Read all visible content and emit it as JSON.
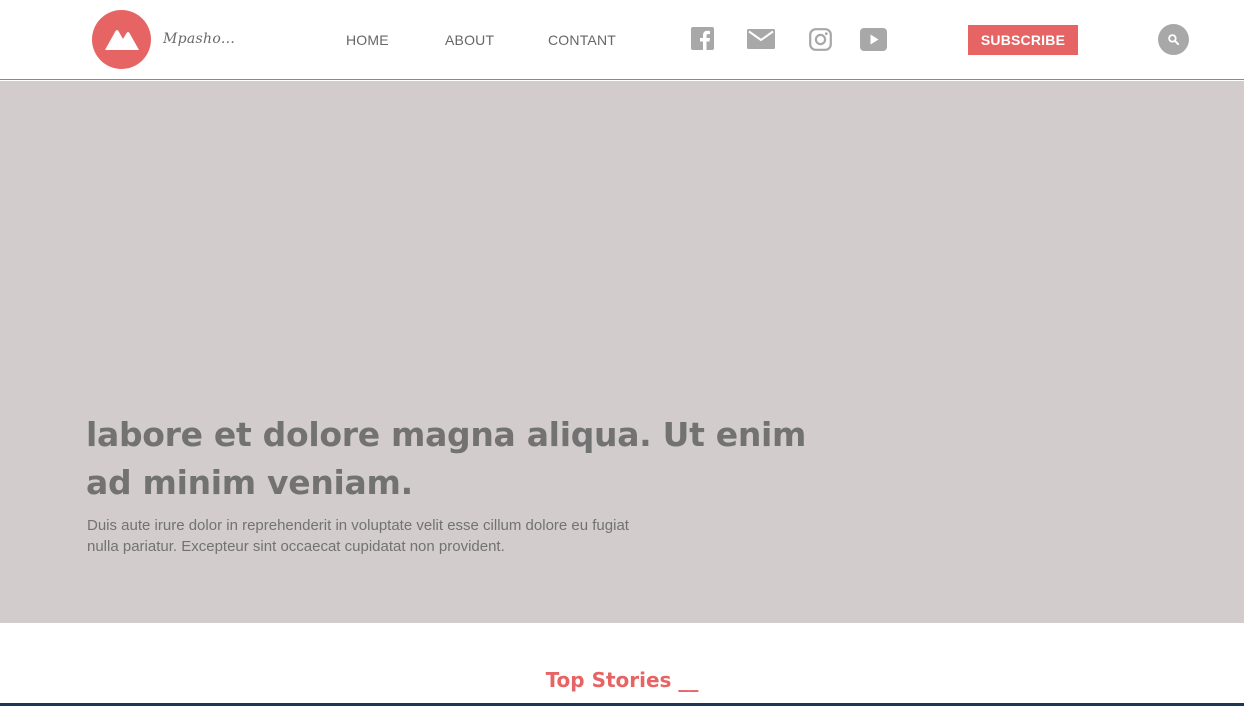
{
  "header": {
    "brand": "Mpasho...",
    "nav": [
      {
        "label": "HOME"
      },
      {
        "label": "ABOUT"
      },
      {
        "label": "CONTANT"
      }
    ],
    "social_icons": [
      "facebook-icon",
      "mail-icon",
      "instagram-icon",
      "youtube-icon"
    ],
    "subscribe_label": "SUBSCRIBE",
    "search_icon": "search-icon"
  },
  "hero": {
    "title": "labore et dolore magna aliqua. Ut enim ad minim veniam.",
    "subtitle": "Duis aute irure dolor in reprehenderit in voluptate velit esse cillum dolore eu fugiat nulla pariatur. Excepteur sint occaecat cupidatat non provident."
  },
  "top_stories": {
    "heading": "Top Stories __"
  },
  "colors": {
    "accent": "#e66464",
    "hero_background": "#d3cccc",
    "text_gray": "#727272",
    "icon_gray": "#a8a8a8"
  }
}
